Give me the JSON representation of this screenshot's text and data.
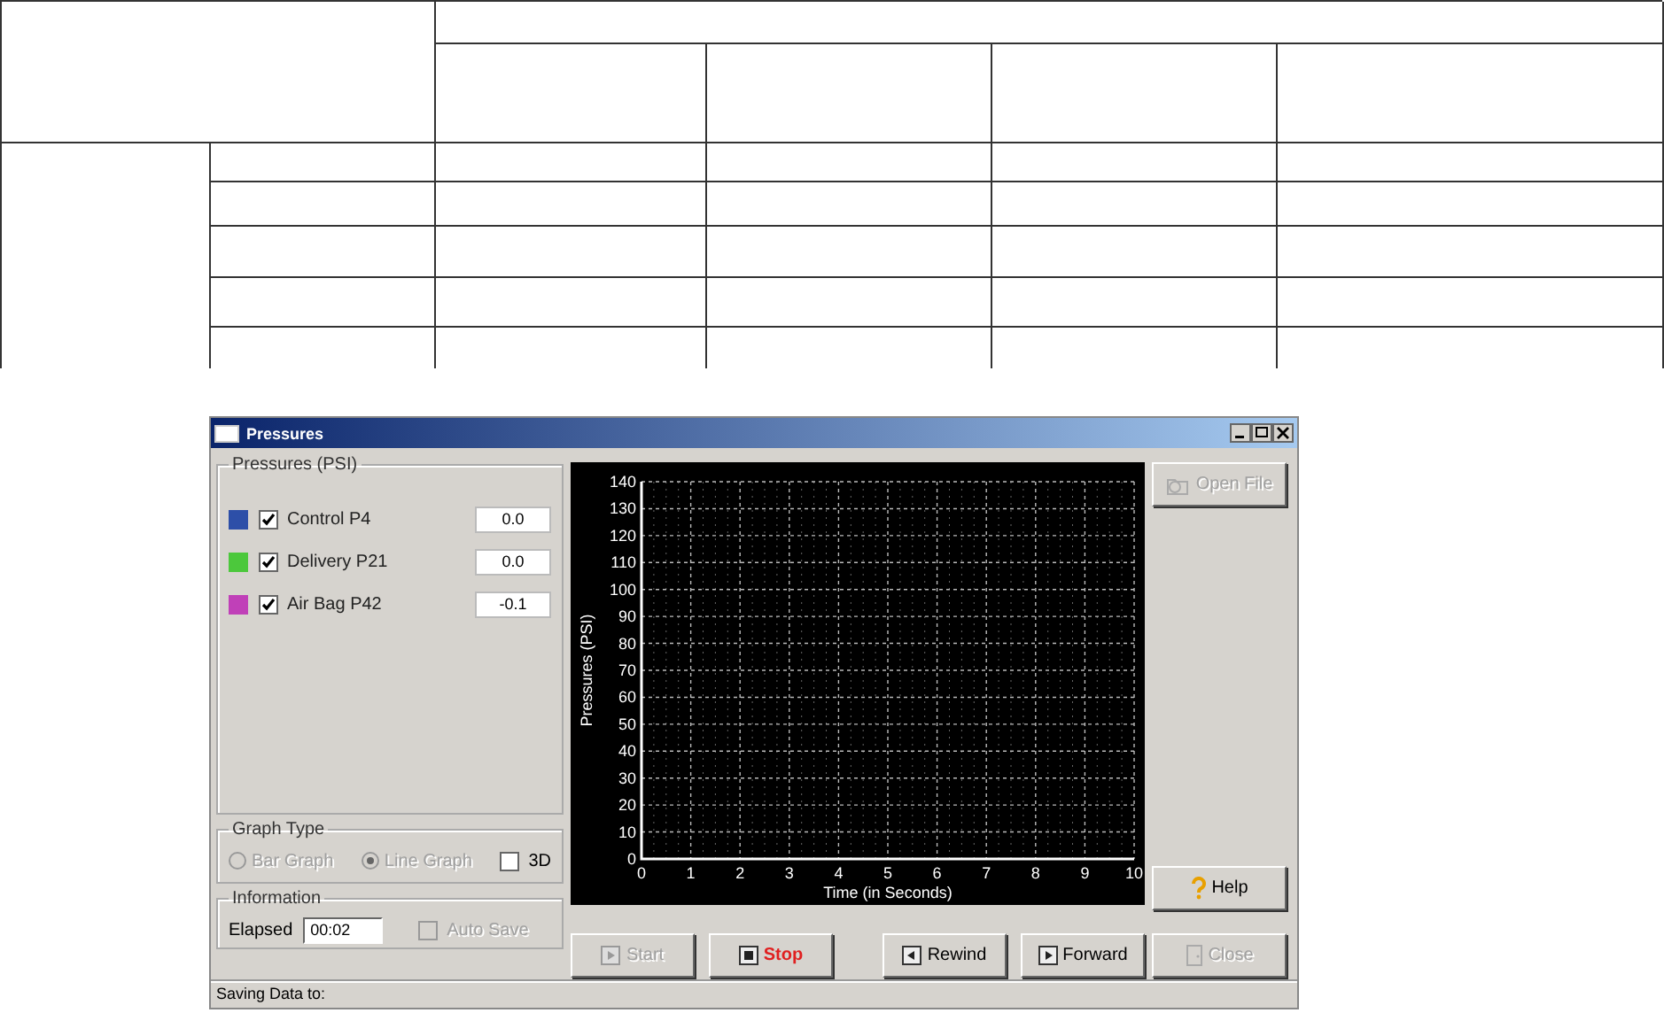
{
  "window": {
    "title": "Pressures"
  },
  "pressures": {
    "title": "Pressures (PSI)",
    "channels": [
      {
        "name": "Control P4",
        "color": "#2d4fa8",
        "checked": true,
        "value": "0.0"
      },
      {
        "name": "Delivery P21",
        "color": "#4cc83c",
        "checked": true,
        "value": "0.0"
      },
      {
        "name": "Air Bag P42",
        "color": "#c040b8",
        "checked": true,
        "value": "-0.1"
      }
    ]
  },
  "graph_type": {
    "title": "Graph Type",
    "options": [
      {
        "kind": "radio",
        "label": "Bar Graph",
        "selected": false,
        "disabled": true
      },
      {
        "kind": "radio",
        "label": "Line Graph",
        "selected": true,
        "disabled": true
      },
      {
        "kind": "checkbox",
        "label": "3D",
        "checked": false,
        "disabled": false
      }
    ]
  },
  "information": {
    "title": "Information",
    "elapsed_label": "Elapsed",
    "elapsed": "00:02",
    "auto_save": {
      "label": "Auto Save",
      "checked": false,
      "disabled": true
    }
  },
  "chart": {
    "chart_data": {
      "type": "line",
      "grid": true,
      "xlabel": "Time (in Seconds)",
      "ylabel": "Pressures (PSI)",
      "xlim": [
        0,
        10
      ],
      "ylim": [
        0,
        140
      ],
      "xticks": [
        0,
        1,
        2,
        3,
        4,
        5,
        6,
        7,
        8,
        9,
        10
      ],
      "yticks": [
        0,
        10,
        20,
        30,
        40,
        50,
        60,
        70,
        80,
        90,
        100,
        110,
        120,
        130,
        140
      ]
    }
  },
  "controls": [
    {
      "kind": "play",
      "label": "Start",
      "disabled": true,
      "alert": false
    },
    {
      "kind": "stop",
      "label": "Stop",
      "disabled": false,
      "alert": true
    },
    {
      "kind": "rewind",
      "label": "Rewind",
      "disabled": false,
      "alert": false
    },
    {
      "kind": "forward",
      "label": "Forward",
      "disabled": false,
      "alert": false
    }
  ],
  "side_buttons": [
    {
      "kind": "open",
      "label": "Open File",
      "disabled": true
    },
    {
      "kind": "help",
      "label": "Help",
      "disabled": false
    },
    {
      "kind": "close",
      "label": "Close",
      "disabled": true
    }
  ],
  "status_bar": "Saving Data to:"
}
